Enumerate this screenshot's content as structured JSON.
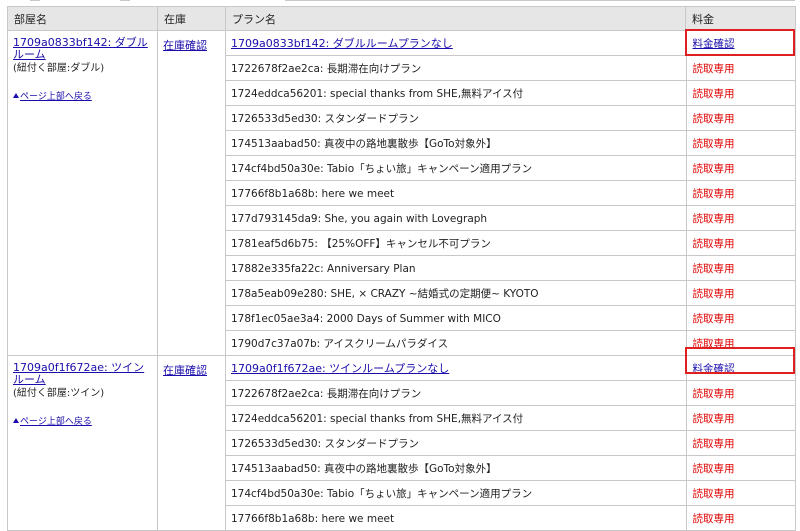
{
  "headers": {
    "room": "部屋名",
    "stock": "在庫",
    "plan": "プラン名",
    "price": "料金"
  },
  "rooms": [
    {
      "name": "1709a0833bf142: ダブルルーム",
      "sub": "(紐付く部屋:ダブル)",
      "back": "ページ上部へ戻る",
      "stock": "在庫確認",
      "plans": [
        {
          "name": "1709a0833bf142: ダブルルームプランなし",
          "price": "料金確認",
          "link": true
        },
        {
          "name": "1722678f2ae2ca: 長期滞在向けプラン",
          "price": "読取専用"
        },
        {
          "name": "1724eddca56201: special thanks from SHE,無料アイス付",
          "price": "読取専用"
        },
        {
          "name": "1726533d5ed30: スタンダードプラン",
          "price": "読取専用"
        },
        {
          "name": "174513aabad50: 真夜中の路地裏散歩【GoTo対象外】",
          "price": "読取専用"
        },
        {
          "name": "174cf4bd50a30e: Tabio「ちょい旅」キャンペーン適用プラン",
          "price": "読取専用"
        },
        {
          "name": "17766f8b1a68b: here we meet",
          "price": "読取専用"
        },
        {
          "name": "177d793145da9: She, you again with Lovegraph",
          "price": "読取専用"
        },
        {
          "name": "1781eaf5d6b75: 【25%OFF】キャンセル不可プラン",
          "price": "読取専用"
        },
        {
          "name": "17882e335fa22c: Anniversary Plan",
          "price": "読取専用"
        },
        {
          "name": "178a5eab09e280: SHE, × CRAZY ~結婚式の定期便~ KYOTO",
          "price": "読取専用"
        },
        {
          "name": "178f1ec05ae3a4: 2000 Days of Summer with MICO",
          "price": "読取専用"
        },
        {
          "name": "1790d7c37a07b: アイスクリームパラダイス",
          "price": "読取専用"
        }
      ]
    },
    {
      "name": "1709a0f1f672ae: ツインルーム",
      "sub": "(紐付く部屋:ツイン)",
      "back": "ページ上部へ戻る",
      "stock": "在庫確認",
      "plans": [
        {
          "name": "1709a0f1f672ae: ツインルームプランなし",
          "price": "料金確認",
          "link": true
        },
        {
          "name": "1722678f2ae2ca: 長期滞在向けプラン",
          "price": "読取専用"
        },
        {
          "name": "1724eddca56201: special thanks from SHE,無料アイス付",
          "price": "読取専用"
        },
        {
          "name": "1726533d5ed30: スタンダードプラン",
          "price": "読取専用"
        },
        {
          "name": "174513aabad50: 真夜中の路地裏散歩【GoTo対象外】",
          "price": "読取専用"
        },
        {
          "name": "174cf4bd50a30e: Tabio「ちょい旅」キャンペーン適用プラン",
          "price": "読取専用"
        },
        {
          "name": "17766f8b1a68b: here we meet",
          "price": "読取専用"
        }
      ]
    }
  ]
}
